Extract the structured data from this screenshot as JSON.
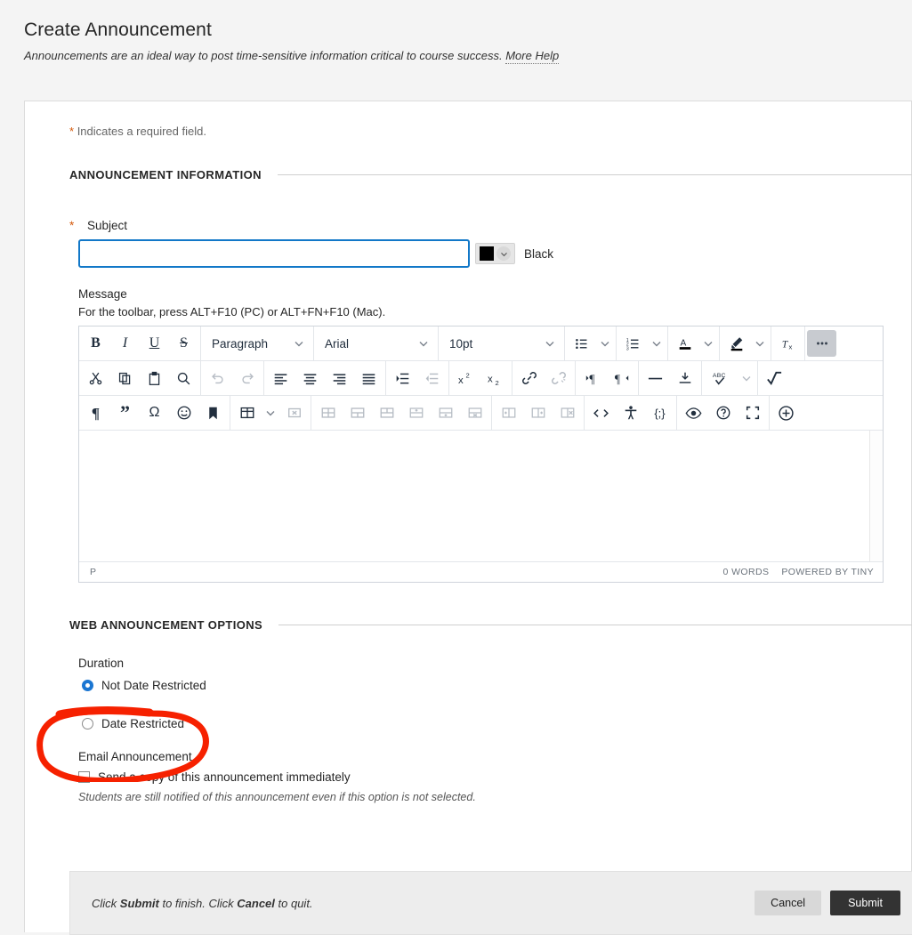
{
  "header": {
    "title": "Create Announcement",
    "subtitle": "Announcements are an ideal way to post time-sensitive information critical to course success.",
    "more_help": "More Help"
  },
  "form": {
    "required_note": "Indicates a required field.",
    "required_star": "*",
    "sections": {
      "announcement_information": "ANNOUNCEMENT INFORMATION",
      "web_announcement_options": "WEB ANNOUNCEMENT OPTIONS"
    },
    "subject": {
      "label": "Subject",
      "value": "",
      "placeholder": ""
    },
    "color": {
      "swatch_hex": "#000000",
      "name": "Black"
    },
    "message": {
      "label": "Message",
      "hint": "For the toolbar, press ALT+F10 (PC) or ALT+FN+F10 (Mac)."
    }
  },
  "editor": {
    "toolbar_row1": {
      "bold": "Bold",
      "italic": "Italic",
      "underline": "Underline",
      "strikethrough": "Strikethrough",
      "block_format": "Paragraph",
      "font_family": "Arial",
      "font_size": "10pt",
      "bullet_list": "Bullet list",
      "numbered_list": "Numbered list",
      "text_color": "Text color",
      "highlight_color": "Background color",
      "clear_formatting": "Clear formatting",
      "more": "Reveal or hide additional toolbar items"
    },
    "toolbar_row2": {
      "cut": "Cut",
      "copy": "Copy",
      "paste": "Paste",
      "find_replace": "Find and replace",
      "undo": "Undo",
      "redo": "Redo",
      "align_left": "Align left",
      "align_center": "Align center",
      "align_right": "Align right",
      "justify": "Justify",
      "indent": "Increase indent",
      "outdent": "Decrease indent",
      "superscript": "Superscript",
      "subscript": "Subscript",
      "link": "Insert/edit link",
      "unlink": "Remove link",
      "ltr": "Left to right",
      "rtl": "Right to left",
      "horizontal_rule": "Horizontal line",
      "page_break": "Page break",
      "spellcheck": "Spellcheck",
      "math": "Insert math"
    },
    "toolbar_row3": {
      "show_blocks": "Show blocks",
      "blockquote": "Blockquote",
      "special_character": "Special character",
      "emoticons": "Emoticons",
      "anchor": "Anchor",
      "table": "Table",
      "delete_table": "Delete table",
      "table_cell_props": "Cell properties",
      "merge_cells": "Merge cells",
      "split_cell": "Split cell",
      "insert_row_before": "Insert row before",
      "insert_row_after": "Insert row after",
      "delete_row": "Delete row",
      "insert_column_before": "Insert column before",
      "insert_column_after": "Insert column after",
      "delete_column": "Delete column",
      "source_code": "Source code",
      "accessibility_check": "Accessibility check",
      "code_sample": "Code sample",
      "preview": "Preview",
      "help": "Help",
      "fullscreen": "Fullscreen",
      "add": "Add content"
    },
    "content": "",
    "status": {
      "element_path": "P",
      "word_count": "0 WORDS",
      "branding": "POWERED BY TINY"
    }
  },
  "web_options": {
    "duration_label": "Duration",
    "duration_options": [
      {
        "label": "Not Date Restricted",
        "selected": true
      },
      {
        "label": "Date Restricted",
        "selected": false
      }
    ],
    "email_label": "Email Announcement",
    "email_checkbox": {
      "label": "Send a copy of this announcement immediately",
      "checked": false
    },
    "email_note": "Students are still notified of this announcement even if this option is not selected."
  },
  "footer": {
    "text_before": "Click ",
    "submit_word": "Submit",
    "text_middle": " to finish. Click ",
    "cancel_word": "Cancel",
    "text_after": " to quit.",
    "cancel_label": "Cancel",
    "submit_label": "Submit"
  },
  "annotation": {
    "shape": "ellipse-highlight",
    "target": "Date Restricted",
    "color": "#f62100"
  },
  "colors": {
    "accent_blue": "#1278c8",
    "required_orange": "#d4590b",
    "submit_dark": "#333333",
    "page_bg": "#f4f4f4",
    "annotation_red": "#f62100"
  }
}
